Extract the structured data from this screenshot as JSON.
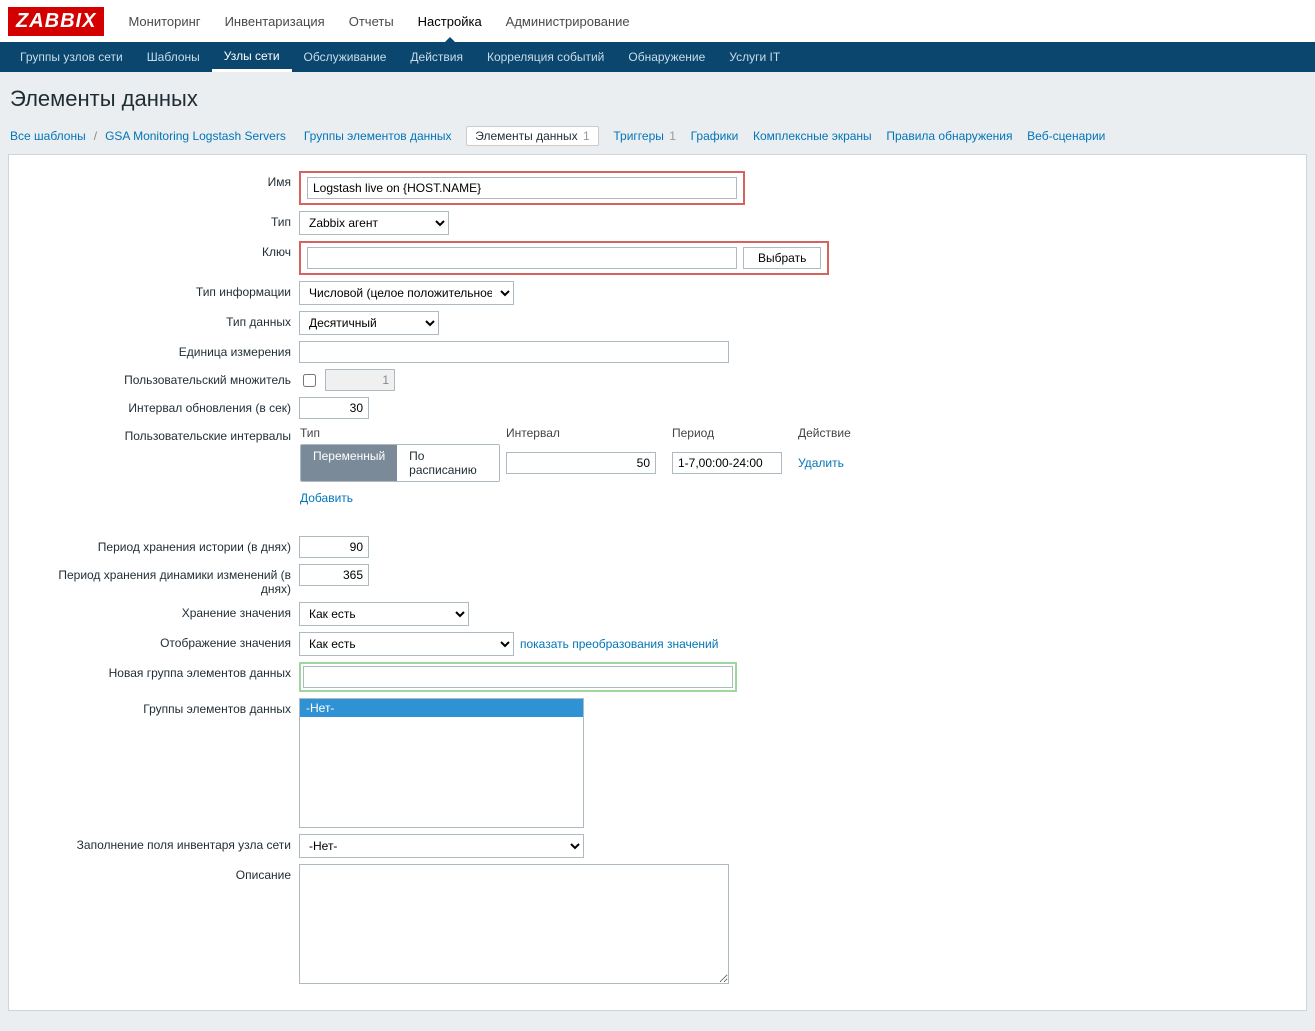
{
  "logo": "ZABBIX",
  "topnav": {
    "items": [
      "Мониторинг",
      "Инвентаризация",
      "Отчеты",
      "Настройка",
      "Администрирование"
    ],
    "active": 3
  },
  "subnav": {
    "items": [
      "Группы узлов сети",
      "Шаблоны",
      "Узлы сети",
      "Обслуживание",
      "Действия",
      "Корреляция событий",
      "Обнаружение",
      "Услуги IT"
    ],
    "active": 2
  },
  "page_title": "Элементы данных",
  "crumbs": {
    "all_templates": "Все шаблоны",
    "template_name": "GSA Monitoring Logstash Servers",
    "links": [
      {
        "label": "Группы элементов данных",
        "count": ""
      },
      {
        "label": "Элементы данных",
        "count": "1",
        "active": true
      },
      {
        "label": "Триггеры",
        "count": "1"
      },
      {
        "label": "Графики",
        "count": ""
      },
      {
        "label": "Комплексные экраны",
        "count": ""
      },
      {
        "label": "Правила обнаружения",
        "count": ""
      },
      {
        "label": "Веб-сценарии",
        "count": ""
      }
    ]
  },
  "form": {
    "name": {
      "label": "Имя",
      "value": "Logstash live on {HOST.NAME}"
    },
    "type": {
      "label": "Тип",
      "value": "Zabbix агент"
    },
    "key": {
      "label": "Ключ",
      "value": "",
      "select_btn": "Выбрать"
    },
    "info_type": {
      "label": "Тип информации",
      "value": "Числовой (целое положительное)"
    },
    "data_type": {
      "label": "Тип данных",
      "value": "Десятичный"
    },
    "unit": {
      "label": "Единица измерения",
      "value": ""
    },
    "multiplier": {
      "label": "Пользовательский множитель",
      "checked": false,
      "value": "1"
    },
    "update_interval": {
      "label": "Интервал обновления (в сек)",
      "value": "30"
    },
    "custom_intervals": {
      "label": "Пользовательские интервалы",
      "head": {
        "type": "Тип",
        "interval": "Интервал",
        "period": "Период",
        "action": "Действие"
      },
      "seg": {
        "flexible": "Переменный",
        "scheduling": "По расписанию"
      },
      "row": {
        "interval": "50",
        "period": "1-7,00:00-24:00",
        "delete": "Удалить"
      },
      "add": "Добавить"
    },
    "history": {
      "label": "Период хранения истории (в днях)",
      "value": "90"
    },
    "trends": {
      "label": "Период хранения динамики изменений (в днях)",
      "value": "365"
    },
    "store_value": {
      "label": "Хранение значения",
      "value": "Как есть"
    },
    "show_value": {
      "label": "Отображение значения",
      "value": "Как есть",
      "link": "показать преобразования значений"
    },
    "new_group": {
      "label": "Новая группа элементов данных",
      "value": ""
    },
    "groups": {
      "label": "Группы элементов данных",
      "none": "-Нет-"
    },
    "inventory": {
      "label": "Заполнение поля инвентаря узла сети",
      "value": "-Нет-"
    },
    "description": {
      "label": "Описание",
      "value": ""
    }
  }
}
